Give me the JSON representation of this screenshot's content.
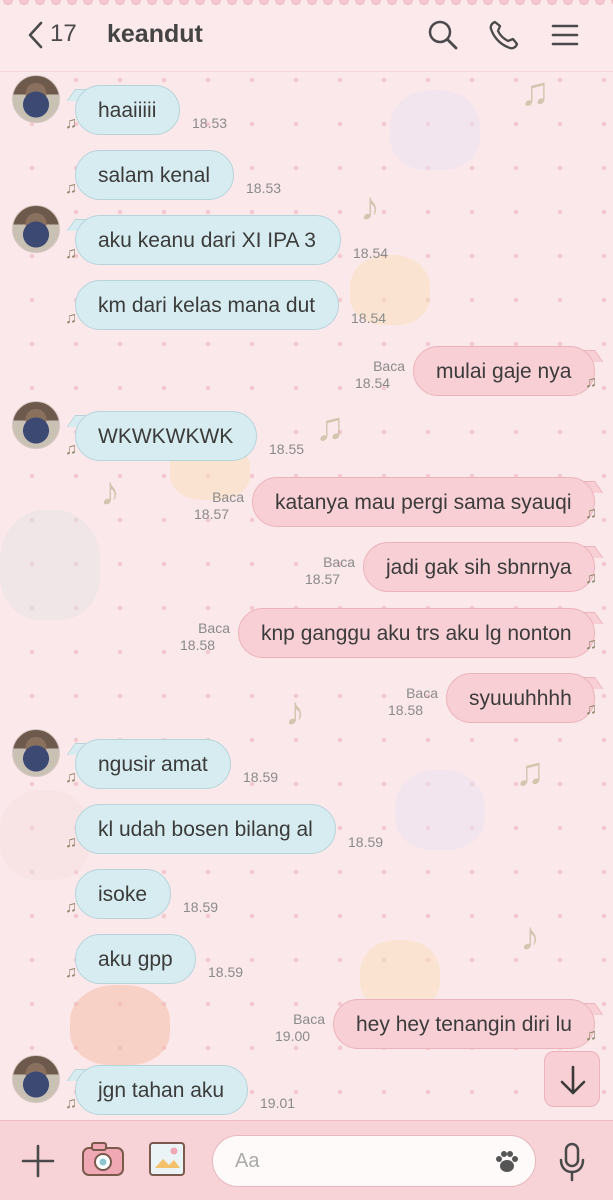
{
  "header": {
    "back_count": "17",
    "title": "keandut",
    "icons": [
      "chevron-left-icon",
      "search-icon",
      "phone-icon",
      "menu-icon"
    ]
  },
  "colors": {
    "incoming_bubble": "#d7ecf0",
    "outgoing_bubble": "#f7cfd5",
    "background": "#fbe8eb"
  },
  "messages": [
    {
      "dir": "in",
      "text": "haaiiiii",
      "time": "18.53"
    },
    {
      "dir": "in",
      "text": "salam kenal",
      "time": "18.53"
    },
    {
      "dir": "in",
      "text": "aku keanu dari XI IPA 3",
      "time": "18.54"
    },
    {
      "dir": "in",
      "text": "km dari kelas mana dut",
      "time": "18.54"
    },
    {
      "dir": "out",
      "text": "mulai gaje nya",
      "time": "18.54",
      "read": "Baca"
    },
    {
      "dir": "in",
      "text": "WKWKWKWK",
      "time": "18.55"
    },
    {
      "dir": "out",
      "text": "katanya mau pergi sama syauqi",
      "time": "18.57",
      "read": "Baca"
    },
    {
      "dir": "out",
      "text": "jadi gak sih sbnrnya",
      "time": "18.57",
      "read": "Baca"
    },
    {
      "dir": "out",
      "text": "knp ganggu aku trs aku lg nonton",
      "time": "18.58",
      "read": "Baca"
    },
    {
      "dir": "out",
      "text": "syuuuhhhh",
      "time": "18.58",
      "read": "Baca"
    },
    {
      "dir": "in",
      "text": "ngusir amat",
      "time": "18.59"
    },
    {
      "dir": "in",
      "text": "kl udah bosen bilang al",
      "time": "18.59"
    },
    {
      "dir": "in",
      "text": "isoke",
      "time": "18.59"
    },
    {
      "dir": "in",
      "text": "aku gpp",
      "time": "18.59"
    },
    {
      "dir": "out",
      "text": "hey hey tenangin diri lu",
      "time": "19.00",
      "read": "Baca"
    },
    {
      "dir": "in",
      "text": "jgn tahan aku",
      "time": "19.01"
    }
  ],
  "input": {
    "placeholder": "Aa",
    "icons": [
      "plus-icon",
      "camera-icon",
      "image-icon",
      "paw-icon",
      "microphone-icon"
    ]
  },
  "scroll_button_icon": "arrow-down-icon"
}
